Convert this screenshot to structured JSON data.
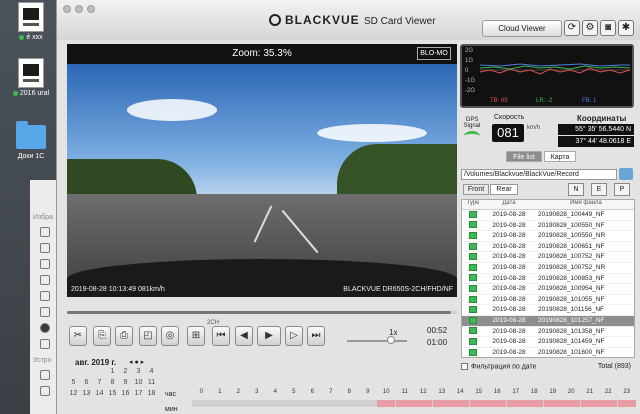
{
  "desktop": {
    "items": [
      {
        "label": "é  xxx"
      },
      {
        "label": "2016 ural"
      },
      {
        "label": "Доки 1С"
      }
    ],
    "finder": {
      "sidebar_label_1": "Избра",
      "sidebar_label_2": "Устро"
    }
  },
  "app": {
    "title": "BLACKVUE",
    "subtitle": "SD Card Viewer",
    "cloud_button": "Cloud Viewer"
  },
  "video": {
    "zoom_text": "Zoom: 35.3%",
    "mode_badge": "BLO-MO",
    "overlay_left": "2019-08-28  10:13:49   081km/h",
    "overlay_right": "BLACKVUE  DR650S-2CH/FHD/NF"
  },
  "playback": {
    "progress": 0.985,
    "channel_label": "2CH",
    "speed": "1x",
    "time_current": "00:52",
    "time_total": "01:00"
  },
  "calendar": {
    "month": "авг. 2019 г.",
    "nav": "◂ ● ▸",
    "rows": [
      [
        "",
        "",
        "",
        "1",
        "2",
        "3",
        "4"
      ],
      [
        "5",
        "6",
        "7",
        "8",
        "9",
        "10",
        "11"
      ],
      [
        "12",
        "13",
        "14",
        "15",
        "16",
        "17",
        "18"
      ]
    ]
  },
  "timeline": {
    "hour_label": "час",
    "minute_label": "мин",
    "hours": [
      "0",
      "1",
      "2",
      "3",
      "4",
      "5",
      "6",
      "7",
      "8",
      "9",
      "10",
      "11",
      "12",
      "13",
      "14",
      "15",
      "16",
      "17",
      "18",
      "19",
      "20",
      "21",
      "22",
      "23"
    ],
    "active_hours": [
      10,
      11,
      12,
      13,
      14,
      15,
      16,
      17,
      18,
      19,
      20,
      21,
      22,
      23
    ]
  },
  "gsensor": {
    "labels": [
      "2G",
      "1G",
      "0",
      "-1G",
      "-2G"
    ],
    "legend": {
      "tb": "TB: 65",
      "lr": "LR: -2",
      "fb": "FB: 1"
    },
    "colors": {
      "tb": "#e05050",
      "lr": "#3cba54",
      "fb": "#4a7fe0"
    }
  },
  "telemetry": {
    "gps_label": "GPS\nSignal",
    "speed_label": "Скорость",
    "speed_value": "081",
    "speed_unit": "km/h",
    "coords_label": "Координаты",
    "lat": "55° 35' 56.5440 N",
    "lon": "37° 44' 48.0618 E"
  },
  "files": {
    "tabs": [
      "File list",
      "Карта"
    ],
    "path": "/Volumes/Blackvue/BlackVue/Record",
    "front": "Front",
    "rear": "Rear",
    "filters": [
      "N",
      "E",
      "P"
    ],
    "headers": {
      "type": "Type",
      "date": "Дата",
      "name": "Имя файла"
    },
    "rows": [
      {
        "date": "2019-08-28",
        "name": "20190828_100449_NF",
        "selected": false
      },
      {
        "date": "2019-08-28",
        "name": "20190828_100550_NF",
        "selected": false
      },
      {
        "date": "2019-08-28",
        "name": "20190828_100550_NR",
        "selected": false
      },
      {
        "date": "2019-08-28",
        "name": "20190828_100651_NF",
        "selected": false
      },
      {
        "date": "2019-08-28",
        "name": "20190828_100752_NF",
        "selected": false
      },
      {
        "date": "2019-08-28",
        "name": "20190828_100752_NR",
        "selected": false
      },
      {
        "date": "2019-08-28",
        "name": "20190828_100853_NF",
        "selected": false
      },
      {
        "date": "2019-08-28",
        "name": "20190828_100954_NF",
        "selected": false
      },
      {
        "date": "2019-08-28",
        "name": "20190828_101055_NF",
        "selected": false
      },
      {
        "date": "2019-08-28",
        "name": "20190828_101156_NF",
        "selected": false
      },
      {
        "date": "2019-08-28",
        "name": "20190828_101257_NF",
        "selected": true
      },
      {
        "date": "2019-08-28",
        "name": "20190828_101358_NF",
        "selected": false
      },
      {
        "date": "2019-08-28",
        "name": "20190828_101459_NF",
        "selected": false
      },
      {
        "date": "2019-08-28",
        "name": "20190828_101600_NF",
        "selected": false
      }
    ],
    "filter_by_date": "Фильтрация по дате",
    "total": "Total (893)"
  }
}
